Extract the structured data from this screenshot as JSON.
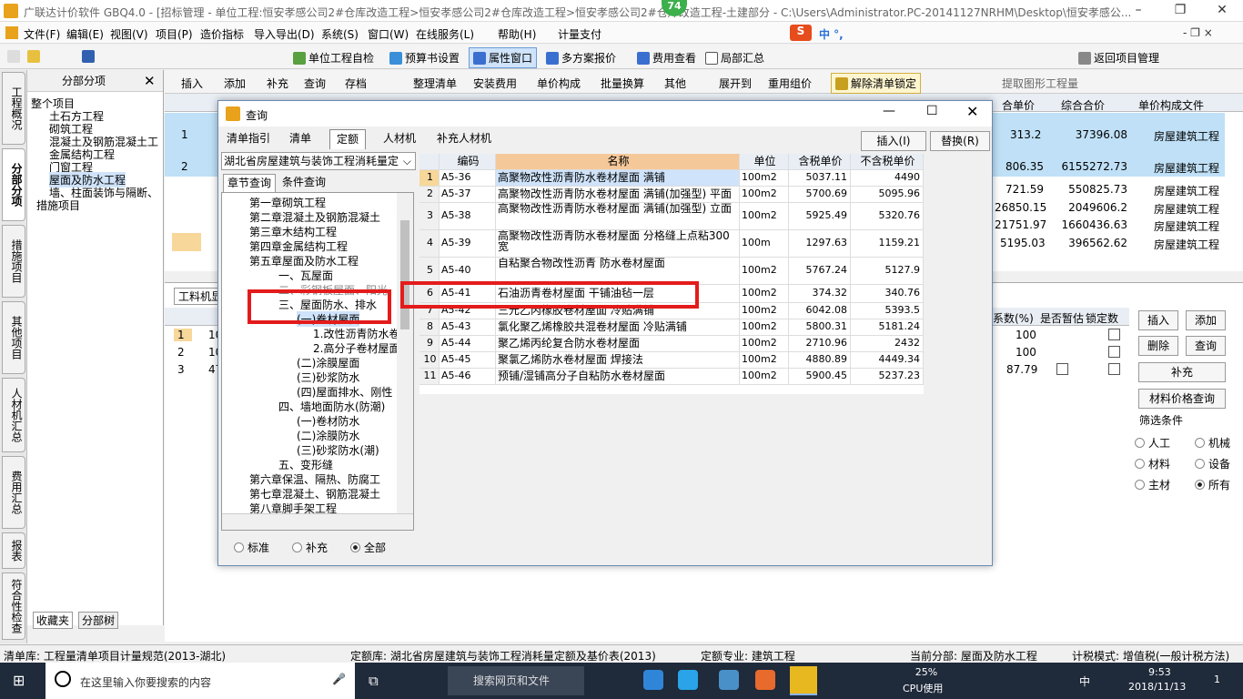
{
  "window": {
    "title": "广联达计价软件 GBQ4.0 - [招标管理 - 单位工程:恒安孝感公司2#仓库改造工程>恒安孝感公司2#仓库改造工程>恒安孝感公司2#仓库改造工程-土建部分 - C:\\Users\\Administrator.PC-20141127NRHM\\Desktop\\恒安孝感公...",
    "badge": "74"
  },
  "menu": [
    "文件(F)",
    "编辑(E)",
    "视图(V)",
    "项目(P)",
    "造价指标",
    "导入导出(D)",
    "系统(S)",
    "窗口(W)",
    "在线服务(L)",
    "帮助(H)",
    "计量支付"
  ],
  "ime": {
    "label": "中 °,",
    "mdi": "- ❐ ×"
  },
  "toolbar1": {
    "check": "单位工程自检",
    "budget": "预算书设置",
    "attr": "属性窗口",
    "multi": "多方案报价",
    "fee": "费用查看",
    "local": "局部汇总",
    "back": "返回项目管理"
  },
  "leftrail": [
    "工程概况",
    "分部分项",
    "措施项目",
    "其他项目",
    "人材机汇总",
    "费用汇总",
    "报表",
    "符合性检查"
  ],
  "fenbu": {
    "header": "分部分项",
    "root": "整个项目",
    "items": [
      "土石方工程",
      "砌筑工程",
      "混凝土及钢筋混凝土工",
      "金属结构工程",
      "门窗工程",
      "屋面及防水工程",
      "墙、柱面装饰与隔断、",
      "措施项目"
    ],
    "bottom": [
      "收藏夹",
      "分部树"
    ]
  },
  "toolbar2": {
    "items": [
      "插入",
      "添加",
      "补充",
      "查询",
      "存档",
      "整理清单",
      "安装费用",
      "单价构成",
      "批量换算",
      "其他",
      "展开到",
      "重用组价",
      "解除清单锁定",
      "提取图形工程量"
    ]
  },
  "maingrid": {
    "headers": [
      "合单价",
      "综合合价",
      "单价构成文件"
    ],
    "rows": [
      [
        "1",
        "313.2",
        "37396.08",
        "房屋建筑工程"
      ],
      [
        "2",
        "806.35",
        "6155272.73",
        "房屋建筑工程"
      ],
      [
        "",
        "721.59",
        "550825.73",
        "房屋建筑工程"
      ],
      [
        "",
        "26850.15",
        "2049606.2",
        "房屋建筑工程"
      ],
      [
        "",
        "21751.97",
        "1660436.63",
        "房屋建筑工程"
      ],
      [
        "",
        "5195.03",
        "396562.62",
        "房屋建筑工程"
      ]
    ]
  },
  "lowergrid": {
    "tab": "工料机显",
    "headers": [
      "系数(%)",
      "是否暂估",
      "锁定数"
    ],
    "rows": [
      [
        "1",
        "10",
        "100"
      ],
      [
        "2",
        "10",
        "100"
      ],
      [
        "3",
        "47",
        "87.79"
      ]
    ]
  },
  "rightbtns": {
    "insert": "插入",
    "add": "添加",
    "delete": "删除",
    "query": "查询",
    "supp": "补充",
    "price": "材料价格查询",
    "filter": "筛选条件",
    "opts": [
      "人工",
      "机械",
      "材料",
      "设备",
      "主材",
      "所有"
    ]
  },
  "dialog": {
    "title": "查询",
    "tabs": [
      "清单指引",
      "清单",
      "定额",
      "人材机",
      "补充人材机"
    ],
    "insert": "插入(I)",
    "replace": "替换(R)",
    "library": "湖北省房屋建筑与装饰工程消耗量定",
    "subtabs": [
      "章节查询",
      "条件查询"
    ],
    "tree": [
      "第一章砌筑工程",
      "第二章混凝土及钢筋混凝土",
      "第三章木结构工程",
      "第四章金属结构工程",
      "第五章屋面及防水工程",
      "一、瓦屋面",
      "二、彩钢板屋面、阳光",
      "三、屋面防水、排水",
      "(一)卷材屋面",
      "1.改性沥青防水卷",
      "2.高分子卷材屋面",
      "(二)涂膜屋面",
      "(三)砂浆防水",
      "(四)屋面排水、刚性",
      "四、墙地面防水(防潮)",
      "(一)卷材防水",
      "(二)涂膜防水",
      "(三)砂浆防水(潮)",
      "五、变形缝",
      "第六章保温、隔热、防腐工",
      "第七章混凝土、钢筋混凝土",
      "第八章脚手架工程"
    ],
    "radios": [
      "标准",
      "补充",
      "全部"
    ],
    "headers": [
      "编码",
      "名称",
      "单位",
      "含税单价",
      "不含税单价"
    ],
    "rows": [
      [
        "1",
        "A5-36",
        "高聚物改性沥青防水卷材屋面 满铺",
        "100m2",
        "5037.11",
        "4490"
      ],
      [
        "2",
        "A5-37",
        "高聚物改性沥青防水卷材屋面 满铺(加强型) 平面",
        "100m2",
        "5700.69",
        "5095.96"
      ],
      [
        "3",
        "A5-38",
        "高聚物改性沥青防水卷材屋面 满铺(加强型) 立面",
        "100m2",
        "5925.49",
        "5320.76"
      ],
      [
        "4",
        "A5-39",
        "高聚物改性沥青防水卷材屋面 分格缝上点粘300宽",
        "100m",
        "1297.63",
        "1159.21"
      ],
      [
        "5",
        "A5-40",
        "自粘聚合物改性沥青 防水卷材屋面",
        "100m2",
        "5767.24",
        "5127.9"
      ],
      [
        "6",
        "A5-41",
        "石油沥青卷材屋面 干铺油毡一层",
        "100m2",
        "374.32",
        "340.76"
      ],
      [
        "7",
        "A5-42",
        "三元乙丙橡胶卷材屋面 冷贴满铺",
        "100m2",
        "6042.08",
        "5393.5"
      ],
      [
        "8",
        "A5-43",
        "氯化聚乙烯橡胶共混卷材屋面 冷贴满铺",
        "100m2",
        "5800.31",
        "5181.24"
      ],
      [
        "9",
        "A5-44",
        "聚乙烯丙纶复合防水卷材屋面",
        "100m2",
        "2710.96",
        "2432"
      ],
      [
        "10",
        "A5-45",
        "聚氯乙烯防水卷材屋面 焊接法",
        "100m2",
        "4880.89",
        "4449.34"
      ],
      [
        "11",
        "A5-46",
        "预铺/湿铺高分子自粘防水卷材屋面",
        "100m2",
        "5900.45",
        "5237.23"
      ]
    ]
  },
  "status": {
    "qd": "清单库: 工程量清单项目计量规范(2013-湖北)",
    "de": "定额库: 湖北省房屋建筑与装饰工程消耗量定额及基价表(2013)",
    "zy": "定额专业: 建筑工程",
    "fb": "当前分部: 屋面及防水工程",
    "ms": "计税模式: 增值税(一般计税方法)"
  },
  "taskbar": {
    "search": "在这里输入你要搜索的内容",
    "websearch": "搜索网页和文件",
    "cpu": "25%",
    "cpulabel": "CPU使用",
    "lang": "中",
    "time": "9:53",
    "date": "2018/11/13",
    "notif": "1"
  }
}
